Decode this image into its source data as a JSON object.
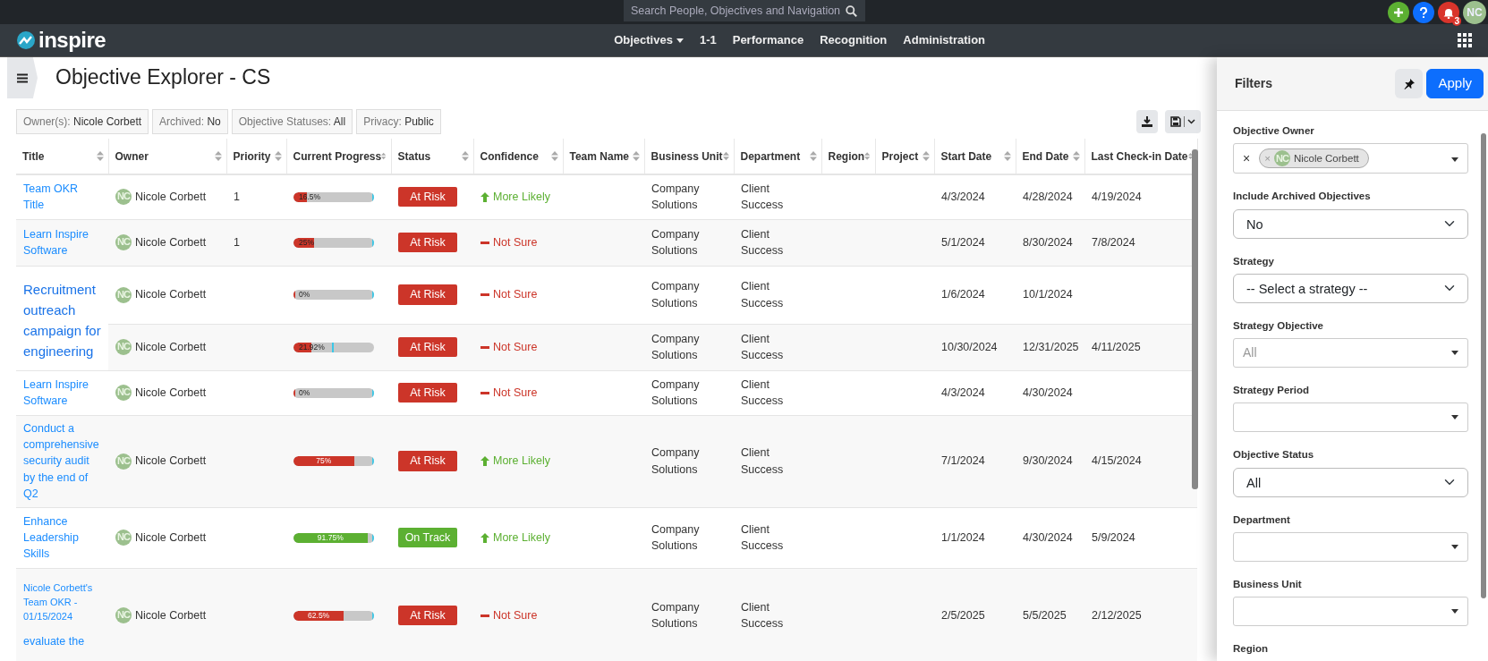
{
  "topbar": {
    "search_placeholder": "Search People, Objectives and Navigation",
    "notifications": "3",
    "user_initials": "NC"
  },
  "navbar": {
    "logo": "inspire",
    "items": [
      {
        "label": "Objectives",
        "dropdown": true
      },
      {
        "label": "1-1",
        "dropdown": false
      },
      {
        "label": "Performance",
        "dropdown": false
      },
      {
        "label": "Recognition",
        "dropdown": false
      },
      {
        "label": "Administration",
        "dropdown": false
      }
    ]
  },
  "page": {
    "title": "Objective Explorer - CS"
  },
  "chips": [
    {
      "key": "Owner(s):",
      "value": "Nicole Corbett"
    },
    {
      "key": "Archived:",
      "value": "No"
    },
    {
      "key": "Objective Statuses:",
      "value": "All"
    },
    {
      "key": "Privacy:",
      "value": "Public"
    }
  ],
  "table": {
    "columns": [
      "Title",
      "Owner",
      "Priority",
      "Current Progress",
      "Status",
      "Confidence",
      "Team Name",
      "Business Unit",
      "Department",
      "Region",
      "Project",
      "Start Date",
      "End Date",
      "Last Check-in Date"
    ],
    "rows": [
      {
        "title": "Team OKR Title",
        "initials": "NC",
        "owner": "Nicole Corbett",
        "priority": "1",
        "progress": {
          "label": "16.5%",
          "level": 0.165,
          "target": {
            "level": 1
          }
        },
        "status": {
          "label": "At Risk",
          "kind": "at-risk"
        },
        "confidence": {
          "label": "More Likely",
          "kind": "up"
        },
        "business_unit": "Company Solutions",
        "department": "Client Success",
        "start": "4/3/2024",
        "end": "4/28/2024",
        "last_checkin": "4/19/2024"
      },
      {
        "title": "Learn Inspire Software",
        "initials": "NC",
        "owner": "Nicole Corbett",
        "priority": "1",
        "progress": {
          "label": "25%",
          "level": 0.25,
          "target": {
            "level": 1
          }
        },
        "status": {
          "label": "At Risk",
          "kind": "at-risk"
        },
        "confidence": {
          "label": "Not Sure",
          "kind": "unsure"
        },
        "business_unit": "Company Solutions",
        "department": "Client Success",
        "start": "5/1/2024",
        "end": "8/30/2024",
        "last_checkin": "7/8/2024"
      },
      {
        "title": "Recruitment outreach campaign for engineering",
        "title_spans_next": true,
        "initials": "NC",
        "owner": "Nicole Corbett",
        "progress": {
          "label": "0%",
          "level": 0.02,
          "target": {
            "level": 1
          }
        },
        "status": {
          "label": "At Risk",
          "kind": "at-risk"
        },
        "confidence": {
          "label": "Not Sure",
          "kind": "unsure"
        },
        "business_unit": "Company Solutions",
        "department": "Client Success",
        "start": "1/6/2024",
        "end": "10/1/2024"
      },
      {
        "initials": "NC",
        "owner": "Nicole Corbett",
        "progress": {
          "label": "21.92%",
          "level": 0.2192,
          "target": {
            "level": 0.5
          }
        },
        "status": {
          "label": "At Risk",
          "kind": "at-risk"
        },
        "confidence": {
          "label": "Not Sure",
          "kind": "unsure"
        },
        "business_unit": "Company Solutions",
        "department": "Client Success",
        "start": "10/30/2024",
        "end": "12/31/2025",
        "last_checkin": "4/11/2025"
      },
      {
        "title": "Learn Inspire Software",
        "initials": "NC",
        "owner": "Nicole Corbett",
        "progress": {
          "label": "0%",
          "level": 0.02,
          "target": {
            "level": 1
          }
        },
        "status": {
          "label": "At Risk",
          "kind": "at-risk"
        },
        "confidence": {
          "label": "Not Sure",
          "kind": "unsure"
        },
        "business_unit": "Company Solutions",
        "department": "Client Success",
        "start": "4/3/2024",
        "end": "4/30/2024"
      },
      {
        "title": "Conduct a comprehensive security audit by the end of Q2",
        "initials": "NC",
        "owner": "Nicole Corbett",
        "progress": {
          "label": "75%",
          "level": 0.75,
          "target": {
            "level": 1
          }
        },
        "status": {
          "label": "At Risk",
          "kind": "at-risk"
        },
        "confidence": {
          "label": "More Likely",
          "kind": "up"
        },
        "business_unit": "Company Solutions",
        "department": "Client Success",
        "start": "7/1/2024",
        "end": "9/30/2024",
        "last_checkin": "4/15/2024"
      },
      {
        "title": "Enhance Leadership Skills",
        "initials": "NC",
        "owner": "Nicole Corbett",
        "progress": {
          "label": "91.75%",
          "level": 0.9175,
          "target": {
            "level": 1
          }
        },
        "status": {
          "label": "On Track",
          "kind": "on-track"
        },
        "confidence": {
          "label": "More Likely",
          "kind": "up"
        },
        "business_unit": "Company Solutions",
        "department": "Client Success",
        "start": "1/1/2024",
        "end": "4/30/2024",
        "last_checkin": "5/9/2024"
      },
      {
        "title": "Nicole Corbett's Team OKR - 01/15/2024",
        "title_small": true,
        "title_note": "evaluate the",
        "initials": "NC",
        "owner": "Nicole Corbett",
        "progress": {
          "label": "62.5%",
          "level": 0.625,
          "target": {
            "level": 1
          }
        },
        "status": {
          "label": "At Risk",
          "kind": "at-risk"
        },
        "confidence": {
          "label": "Not Sure",
          "kind": "unsure"
        },
        "business_unit": "Company Solutions",
        "department": "Client Success",
        "start": "2/5/2025",
        "end": "5/5/2025",
        "last_checkin": "2/12/2025"
      }
    ]
  },
  "filters": {
    "title": "Filters",
    "apply": "Apply",
    "fields": [
      {
        "label": "Objective Owner",
        "kind": "multiselect",
        "clear": "×",
        "tag": {
          "remove": "×",
          "initials": "NC",
          "label": "Nicole Corbett"
        }
      },
      {
        "label": "Include Archived Objectives",
        "kind": "select",
        "value": "No"
      },
      {
        "label": "Strategy",
        "kind": "select",
        "value": "-- Select a strategy --"
      },
      {
        "label": "Strategy Objective",
        "kind": "combo",
        "placeholder": "All"
      },
      {
        "label": "Strategy Period",
        "kind": "combo"
      },
      {
        "label": "Objective Status",
        "kind": "select",
        "value": "All"
      },
      {
        "label": "Department",
        "kind": "combo"
      },
      {
        "label": "Business Unit",
        "kind": "combo"
      },
      {
        "label": "Region",
        "kind": "cut"
      }
    ]
  }
}
